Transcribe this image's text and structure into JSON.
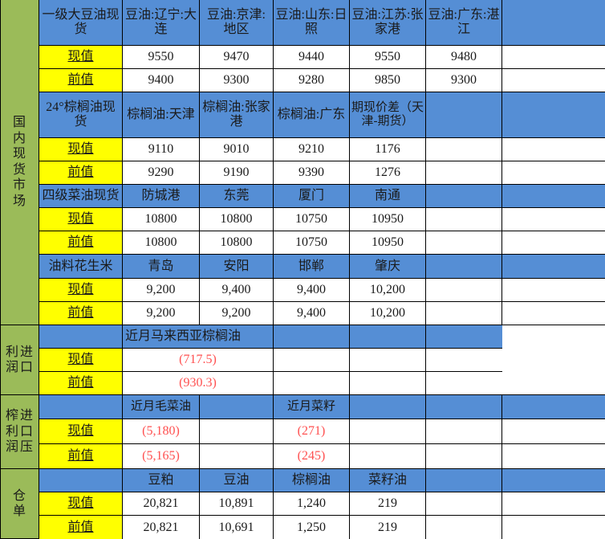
{
  "sidebar": {
    "sections": [
      {
        "id": "domestic-spot-market",
        "label": "国内现货市场",
        "chars": [
          "国",
          "内",
          "现",
          "货",
          "市",
          "场"
        ],
        "columns": [
          [
            "国",
            "内",
            "现",
            "货",
            "市",
            "场"
          ]
        ]
      },
      {
        "id": "import-profit",
        "label": "进口利润",
        "columns": [
          [
            "利",
            "润"
          ],
          [
            "进",
            "口"
          ]
        ]
      },
      {
        "id": "import-crush-profit",
        "label": "进口压榨利润",
        "columns": [
          [
            "榨",
            "利",
            "润"
          ],
          [
            "进",
            "口",
            "压"
          ]
        ]
      },
      {
        "id": "warehouse-receipt",
        "label": "仓单",
        "columns": [
          [
            "仓",
            "单"
          ]
        ]
      }
    ]
  },
  "labels": {
    "current": "现值",
    "previous": "前值"
  },
  "blocks": {
    "soybean_oil": {
      "row_label": "一级大豆油现货",
      "headers": [
        "豆油:辽宁:大连",
        "豆油:京津:地区",
        "豆油:山东:日照",
        "豆油:江苏:张家港",
        "豆油:广东:湛江",
        ""
      ],
      "current": [
        "9550",
        "9470",
        "9440",
        "9550",
        "9480",
        ""
      ],
      "previous": [
        "9400",
        "9300",
        "9280",
        "9850",
        "9300",
        ""
      ]
    },
    "palm_oil": {
      "row_label": "24°棕榈油现货",
      "headers": [
        "棕榈油:天津",
        "棕榈油:张家港",
        "棕榈油:广东",
        "期现价差（天津-期货）",
        "",
        ""
      ],
      "current": [
        "9110",
        "9010",
        "9210",
        "1176",
        "",
        ""
      ],
      "previous": [
        "9290",
        "9190",
        "9390",
        "1276",
        "",
        ""
      ]
    },
    "rapeseed_oil": {
      "row_label": "四级菜油现货",
      "headers": [
        "防城港",
        "东莞",
        "厦门",
        "南通",
        "",
        ""
      ],
      "current": [
        "10800",
        "10800",
        "10750",
        "10950",
        "",
        ""
      ],
      "previous": [
        "10800",
        "10800",
        "10750",
        "10950",
        "",
        ""
      ]
    },
    "peanut": {
      "row_label": "油料花生米",
      "headers": [
        "青岛",
        "安阳",
        "邯郸",
        "肇庆",
        "",
        ""
      ],
      "current": [
        "9,200",
        "9,400",
        "9,400",
        "10,200",
        "",
        ""
      ],
      "previous": [
        "9,200",
        "9,200",
        "9,400",
        "10,200",
        "",
        ""
      ]
    },
    "import_profit": {
      "row_label": "",
      "header_merged": "近月马来西亚棕榈油",
      "headers_rest": [
        "",
        "",
        "",
        ""
      ],
      "current_merged": "(717.5)",
      "previous_merged": "(930.3)",
      "current_rest": [
        "",
        "",
        "",
        ""
      ],
      "previous_rest": [
        "",
        "",
        "",
        ""
      ]
    },
    "import_crush_profit": {
      "row_label": "",
      "headers": [
        "近月毛菜油",
        "",
        "近月菜籽",
        "",
        "",
        ""
      ],
      "current": [
        "(5,180)",
        "",
        "(271)",
        "",
        "",
        ""
      ],
      "previous": [
        "(5,165)",
        "",
        "(245)",
        "",
        "",
        ""
      ]
    },
    "warehouse_receipt": {
      "row_label": "",
      "headers": [
        "豆粕",
        "豆油",
        "棕榈油",
        "菜籽油",
        "",
        ""
      ],
      "current": [
        "20,821",
        "10,891",
        "1,240",
        "219",
        "",
        ""
      ],
      "previous": [
        "20,821",
        "10,691",
        "1,250",
        "219",
        "",
        ""
      ]
    }
  },
  "colors": {
    "sidebar_green": "#9BBB59",
    "header_blue": "#558ED5",
    "label_yellow": "#FFFF00",
    "value_white": "#FFFFFF",
    "negative_red": "#FF5050",
    "grid_black": "#000000"
  }
}
